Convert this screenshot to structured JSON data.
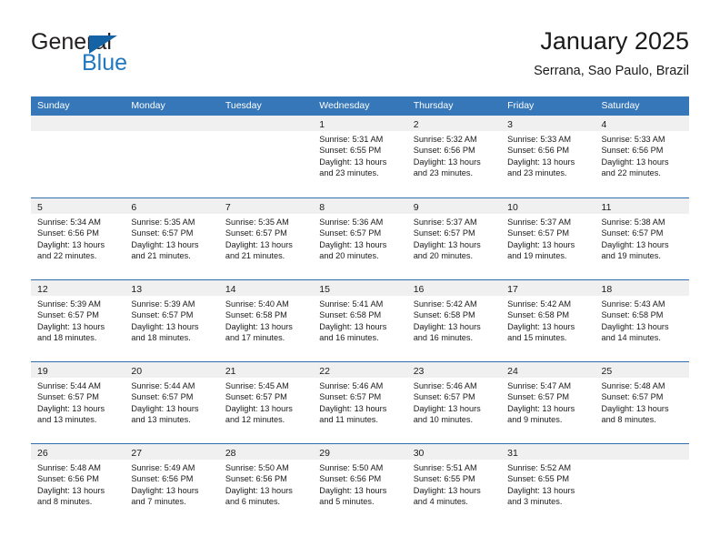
{
  "brand": {
    "name_top": "General",
    "name_bottom": "Blue",
    "triangle_icon": "blue-triangle-icon",
    "colors": {
      "blue": "#1f78c1",
      "triangle": "#1464a5",
      "text": "#231f20"
    }
  },
  "header": {
    "title": "January 2025",
    "subtitle": "Serrana, Sao Paulo, Brazil"
  },
  "theme": {
    "header_blue": "#3577b8",
    "row_divider_blue": "#2f6fae",
    "day_band_gray": "#f0f0f0"
  },
  "weekdays": [
    "Sunday",
    "Monday",
    "Tuesday",
    "Wednesday",
    "Thursday",
    "Friday",
    "Saturday"
  ],
  "weeks": [
    [
      {
        "day": "",
        "lines": []
      },
      {
        "day": "",
        "lines": []
      },
      {
        "day": "",
        "lines": []
      },
      {
        "day": "1",
        "lines": [
          "Sunrise: 5:31 AM",
          "Sunset: 6:55 PM",
          "Daylight: 13 hours",
          "and 23 minutes."
        ]
      },
      {
        "day": "2",
        "lines": [
          "Sunrise: 5:32 AM",
          "Sunset: 6:56 PM",
          "Daylight: 13 hours",
          "and 23 minutes."
        ]
      },
      {
        "day": "3",
        "lines": [
          "Sunrise: 5:33 AM",
          "Sunset: 6:56 PM",
          "Daylight: 13 hours",
          "and 23 minutes."
        ]
      },
      {
        "day": "4",
        "lines": [
          "Sunrise: 5:33 AM",
          "Sunset: 6:56 PM",
          "Daylight: 13 hours",
          "and 22 minutes."
        ]
      }
    ],
    [
      {
        "day": "5",
        "lines": [
          "Sunrise: 5:34 AM",
          "Sunset: 6:56 PM",
          "Daylight: 13 hours",
          "and 22 minutes."
        ]
      },
      {
        "day": "6",
        "lines": [
          "Sunrise: 5:35 AM",
          "Sunset: 6:57 PM",
          "Daylight: 13 hours",
          "and 21 minutes."
        ]
      },
      {
        "day": "7",
        "lines": [
          "Sunrise: 5:35 AM",
          "Sunset: 6:57 PM",
          "Daylight: 13 hours",
          "and 21 minutes."
        ]
      },
      {
        "day": "8",
        "lines": [
          "Sunrise: 5:36 AM",
          "Sunset: 6:57 PM",
          "Daylight: 13 hours",
          "and 20 minutes."
        ]
      },
      {
        "day": "9",
        "lines": [
          "Sunrise: 5:37 AM",
          "Sunset: 6:57 PM",
          "Daylight: 13 hours",
          "and 20 minutes."
        ]
      },
      {
        "day": "10",
        "lines": [
          "Sunrise: 5:37 AM",
          "Sunset: 6:57 PM",
          "Daylight: 13 hours",
          "and 19 minutes."
        ]
      },
      {
        "day": "11",
        "lines": [
          "Sunrise: 5:38 AM",
          "Sunset: 6:57 PM",
          "Daylight: 13 hours",
          "and 19 minutes."
        ]
      }
    ],
    [
      {
        "day": "12",
        "lines": [
          "Sunrise: 5:39 AM",
          "Sunset: 6:57 PM",
          "Daylight: 13 hours",
          "and 18 minutes."
        ]
      },
      {
        "day": "13",
        "lines": [
          "Sunrise: 5:39 AM",
          "Sunset: 6:57 PM",
          "Daylight: 13 hours",
          "and 18 minutes."
        ]
      },
      {
        "day": "14",
        "lines": [
          "Sunrise: 5:40 AM",
          "Sunset: 6:58 PM",
          "Daylight: 13 hours",
          "and 17 minutes."
        ]
      },
      {
        "day": "15",
        "lines": [
          "Sunrise: 5:41 AM",
          "Sunset: 6:58 PM",
          "Daylight: 13 hours",
          "and 16 minutes."
        ]
      },
      {
        "day": "16",
        "lines": [
          "Sunrise: 5:42 AM",
          "Sunset: 6:58 PM",
          "Daylight: 13 hours",
          "and 16 minutes."
        ]
      },
      {
        "day": "17",
        "lines": [
          "Sunrise: 5:42 AM",
          "Sunset: 6:58 PM",
          "Daylight: 13 hours",
          "and 15 minutes."
        ]
      },
      {
        "day": "18",
        "lines": [
          "Sunrise: 5:43 AM",
          "Sunset: 6:58 PM",
          "Daylight: 13 hours",
          "and 14 minutes."
        ]
      }
    ],
    [
      {
        "day": "19",
        "lines": [
          "Sunrise: 5:44 AM",
          "Sunset: 6:57 PM",
          "Daylight: 13 hours",
          "and 13 minutes."
        ]
      },
      {
        "day": "20",
        "lines": [
          "Sunrise: 5:44 AM",
          "Sunset: 6:57 PM",
          "Daylight: 13 hours",
          "and 13 minutes."
        ]
      },
      {
        "day": "21",
        "lines": [
          "Sunrise: 5:45 AM",
          "Sunset: 6:57 PM",
          "Daylight: 13 hours",
          "and 12 minutes."
        ]
      },
      {
        "day": "22",
        "lines": [
          "Sunrise: 5:46 AM",
          "Sunset: 6:57 PM",
          "Daylight: 13 hours",
          "and 11 minutes."
        ]
      },
      {
        "day": "23",
        "lines": [
          "Sunrise: 5:46 AM",
          "Sunset: 6:57 PM",
          "Daylight: 13 hours",
          "and 10 minutes."
        ]
      },
      {
        "day": "24",
        "lines": [
          "Sunrise: 5:47 AM",
          "Sunset: 6:57 PM",
          "Daylight: 13 hours",
          "and 9 minutes."
        ]
      },
      {
        "day": "25",
        "lines": [
          "Sunrise: 5:48 AM",
          "Sunset: 6:57 PM",
          "Daylight: 13 hours",
          "and 8 minutes."
        ]
      }
    ],
    [
      {
        "day": "26",
        "lines": [
          "Sunrise: 5:48 AM",
          "Sunset: 6:56 PM",
          "Daylight: 13 hours",
          "and 8 minutes."
        ]
      },
      {
        "day": "27",
        "lines": [
          "Sunrise: 5:49 AM",
          "Sunset: 6:56 PM",
          "Daylight: 13 hours",
          "and 7 minutes."
        ]
      },
      {
        "day": "28",
        "lines": [
          "Sunrise: 5:50 AM",
          "Sunset: 6:56 PM",
          "Daylight: 13 hours",
          "and 6 minutes."
        ]
      },
      {
        "day": "29",
        "lines": [
          "Sunrise: 5:50 AM",
          "Sunset: 6:56 PM",
          "Daylight: 13 hours",
          "and 5 minutes."
        ]
      },
      {
        "day": "30",
        "lines": [
          "Sunrise: 5:51 AM",
          "Sunset: 6:55 PM",
          "Daylight: 13 hours",
          "and 4 minutes."
        ]
      },
      {
        "day": "31",
        "lines": [
          "Sunrise: 5:52 AM",
          "Sunset: 6:55 PM",
          "Daylight: 13 hours",
          "and 3 minutes."
        ]
      },
      {
        "day": "",
        "lines": []
      }
    ]
  ]
}
